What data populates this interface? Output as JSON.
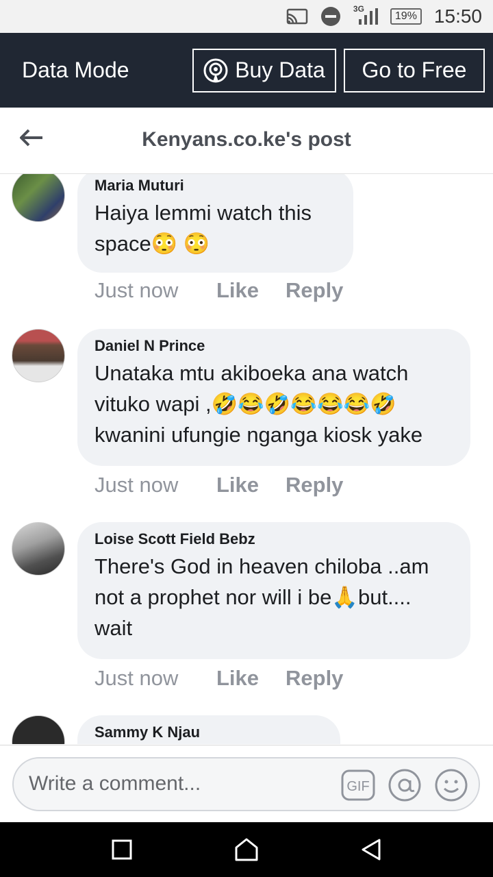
{
  "status_bar": {
    "network": "3G",
    "battery": "19%",
    "time": "15:50"
  },
  "data_bar": {
    "label": "Data Mode",
    "buy_data": "Buy Data",
    "go_free": "Go to Free"
  },
  "header": {
    "title": "Kenyans.co.ke's post"
  },
  "comments": [
    {
      "author": "Maria Muturi",
      "text": "Haiya lemmi watch this space😳 😳",
      "time": "Just now",
      "like": "Like",
      "reply": "Reply"
    },
    {
      "author": "Daniel N Prince",
      "text": "Unataka mtu akiboeka ana watch vituko wapi ,🤣😂🤣😂😂😂🤣 kwanini ufungie nganga kiosk yake",
      "time": "Just now",
      "like": "Like",
      "reply": "Reply"
    },
    {
      "author": "Loise Scott Field Bebz",
      "text": "There's God in heaven chiloba ..am not a prophet nor will i be🙏but.... wait",
      "time": "Just now",
      "like": "Like",
      "reply": "Reply"
    },
    {
      "author": "Sammy K Njau",
      "text": ""
    }
  ],
  "composer": {
    "placeholder": "Write a comment...",
    "gif_label": "GIF"
  }
}
